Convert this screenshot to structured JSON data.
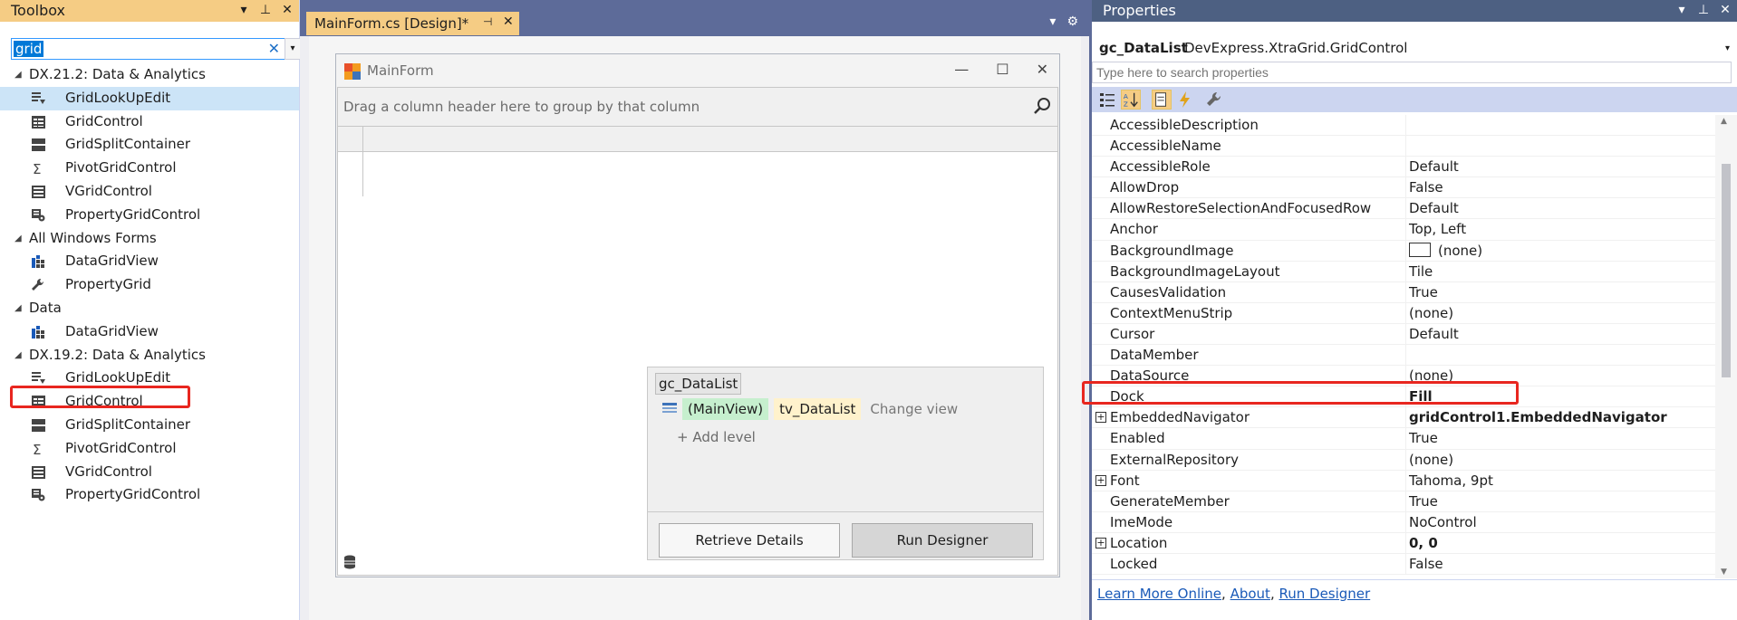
{
  "toolbox": {
    "title": "Toolbox",
    "search_value": "grid",
    "groups": [
      {
        "label": "DX.21.2: Data & Analytics",
        "items": [
          {
            "label": "GridLookUpEdit",
            "icon": "grid-lookup-icon"
          },
          {
            "label": "GridControl",
            "icon": "grid-control-icon"
          },
          {
            "label": "GridSplitContainer",
            "icon": "grid-split-icon"
          },
          {
            "label": "PivotGridControl",
            "icon": "pivot-sigma-icon"
          },
          {
            "label": "VGridControl",
            "icon": "vgrid-icon"
          },
          {
            "label": "PropertyGridControl",
            "icon": "property-grid-icon"
          }
        ]
      },
      {
        "label": "All Windows Forms",
        "items": [
          {
            "label": "DataGridView",
            "icon": "datagridview-icon"
          },
          {
            "label": "PropertyGrid",
            "icon": "wrench-icon"
          }
        ]
      },
      {
        "label": "Data",
        "items": [
          {
            "label": "DataGridView",
            "icon": "datagridview-icon"
          }
        ]
      },
      {
        "label": "DX.19.2: Data & Analytics",
        "items": [
          {
            "label": "GridLookUpEdit",
            "icon": "grid-lookup-icon"
          },
          {
            "label": "GridControl",
            "icon": "grid-control-icon"
          },
          {
            "label": "GridSplitContainer",
            "icon": "grid-split-icon"
          },
          {
            "label": "PivotGridControl",
            "icon": "pivot-sigma-icon"
          },
          {
            "label": "VGridControl",
            "icon": "vgrid-icon"
          },
          {
            "label": "PropertyGridControl",
            "icon": "property-grid-icon"
          }
        ]
      }
    ]
  },
  "designer": {
    "tab_label": "MainForm.cs [Design]*",
    "form_title": "MainForm",
    "group_panel_text": "Drag a column header here to group by that column",
    "smart_tag": {
      "title": "gc_DataList",
      "main_view": "(MainView)",
      "view_name": "tv_DataList",
      "change_view": "Change view",
      "add_level": "Add level",
      "retrieve_details": "Retrieve Details",
      "run_designer": "Run Designer"
    }
  },
  "properties": {
    "title": "Properties",
    "object_name": "gc_DataList",
    "object_type": "DevExpress.XtraGrid.GridControl",
    "search_placeholder": "Type here to search properties",
    "rows": [
      {
        "name": "AccessibleDescription",
        "value": ""
      },
      {
        "name": "AccessibleName",
        "value": ""
      },
      {
        "name": "AccessibleRole",
        "value": "Default"
      },
      {
        "name": "AllowDrop",
        "value": "False"
      },
      {
        "name": "AllowRestoreSelectionAndFocusedRow",
        "value": "Default"
      },
      {
        "name": "Anchor",
        "value": "Top, Left"
      },
      {
        "name": "BackgroundImage",
        "value": "(none)",
        "swatch": true
      },
      {
        "name": "BackgroundImageLayout",
        "value": "Tile"
      },
      {
        "name": "CausesValidation",
        "value": "True"
      },
      {
        "name": "ContextMenuStrip",
        "value": "(none)"
      },
      {
        "name": "Cursor",
        "value": "Default"
      },
      {
        "name": "DataMember",
        "value": ""
      },
      {
        "name": "DataSource",
        "value": "(none)"
      },
      {
        "name": "Dock",
        "value": "Fill",
        "bold": true
      },
      {
        "name": "EmbeddedNavigator",
        "value": "gridControl1.EmbeddedNavigator",
        "bold": true,
        "expandable": true
      },
      {
        "name": "Enabled",
        "value": "True"
      },
      {
        "name": "ExternalRepository",
        "value": "(none)"
      },
      {
        "name": "Font",
        "value": "Tahoma, 9pt",
        "expandable": true
      },
      {
        "name": "GenerateMember",
        "value": "True"
      },
      {
        "name": "ImeMode",
        "value": "NoControl"
      },
      {
        "name": "Location",
        "value": "0, 0",
        "bold": true,
        "expandable": true
      },
      {
        "name": "Locked",
        "value": "False"
      }
    ],
    "footer_links": [
      "Learn More Online",
      "About",
      "Run Designer"
    ]
  },
  "colors": {
    "accent_title": "#f5cc84",
    "highlight_border": "#e8261f",
    "vs_frame": "#5d6b99"
  }
}
